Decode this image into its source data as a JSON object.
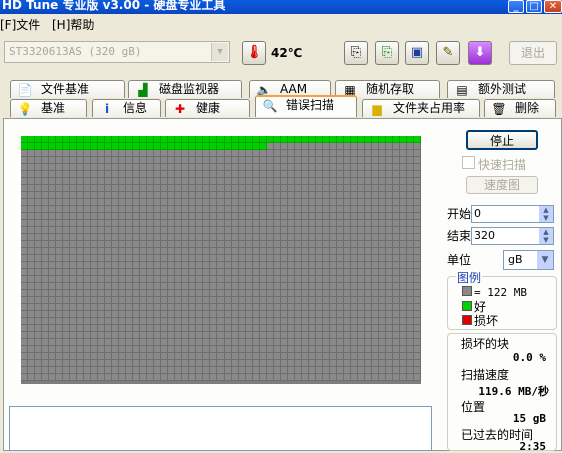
{
  "window": {
    "title": "HD Tune 专业版 v3.00 - 硬盘专业工具"
  },
  "menu": {
    "file": "[F]文件",
    "help": "[H]帮助"
  },
  "toolbar": {
    "drive": "ST3320613AS (320 gB)",
    "temperature": "42℃",
    "exit_label": "退出",
    "buttons": [
      "copy-info-icon",
      "copy-all-icon",
      "save-icon",
      "options-icon",
      "download-icon"
    ]
  },
  "tabs": {
    "row1": [
      "文件基准",
      "磁盘监视器",
      "AAM",
      "随机存取",
      "额外测试"
    ],
    "row2": [
      "基准",
      "信息",
      "健康",
      "错误扫描",
      "文件夹占用率",
      "删除"
    ],
    "active": "错误扫描"
  },
  "scan": {
    "stop_label": "停止",
    "quick_scan_label": "快速扫描",
    "quick_scan_checked": false,
    "speed_map_label": "速度图",
    "start_label": "开始",
    "start_value": "0",
    "end_label": "结束",
    "end_value": "320",
    "unit_label": "单位",
    "unit_value": "gB",
    "grid": {
      "columns": 57,
      "rows": 35,
      "scanned_blocks": 92
    },
    "legend": {
      "title": "图例",
      "block_size": "= 122 MB",
      "good": "好",
      "damaged": "损坏",
      "colors": {
        "block": "#8a8a8a",
        "good": "#00d000",
        "damaged": "#e00000"
      }
    },
    "stats": {
      "damaged_blocks_label": "损坏的块",
      "damaged_blocks_value": "0.0 %",
      "scan_speed_label": "扫描速度",
      "scan_speed_value": "119.6 MB/秒",
      "position_label": "位置",
      "position_value": "15 gB",
      "elapsed_label": "已过去的时间",
      "elapsed_value": "2:35"
    }
  }
}
